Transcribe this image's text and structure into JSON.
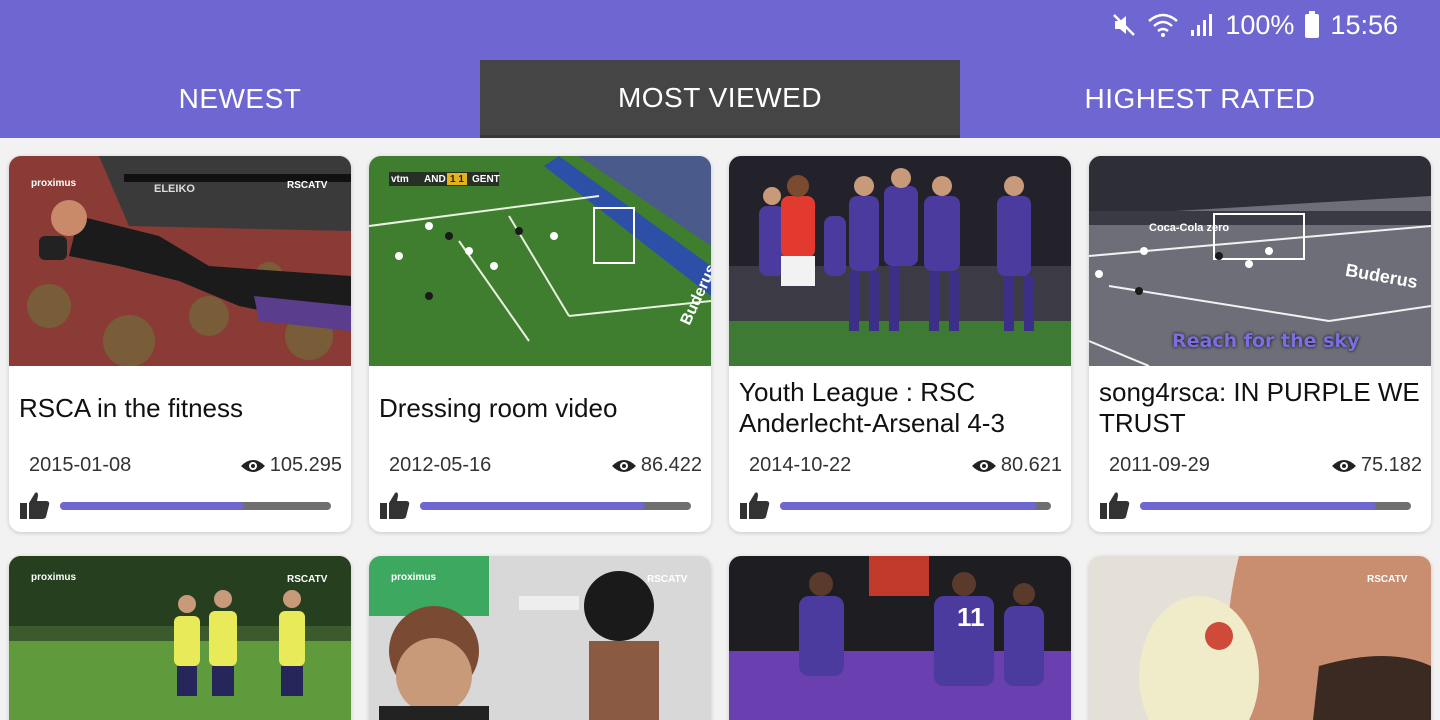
{
  "status": {
    "battery": "100%",
    "time": "15:56"
  },
  "tabs": [
    {
      "label": "NEWEST",
      "active": false
    },
    {
      "label": "MOST VIEWED",
      "active": true
    },
    {
      "label": "HIGHEST RATED",
      "active": false
    }
  ],
  "colors": {
    "accent": "#6f67d1",
    "active_tab": "#454545",
    "bar_track": "#6f6f6f"
  },
  "videos": [
    {
      "title": "RSCA in the fitness",
      "date": "2015-01-08",
      "views": "105.295",
      "rating": 0.68
    },
    {
      "title": "Dressing room video",
      "date": "2012-05-16",
      "views": "86.422",
      "rating": 0.83
    },
    {
      "title": "Youth League : RSC Anderlecht-Arsenal 4-3",
      "date": "2014-10-22",
      "views": "80.621",
      "rating": 0.95
    },
    {
      "title": "song4rsca: IN PURPLE WE TRUST",
      "date": "2011-09-29",
      "views": "75.182",
      "rating": 0.87
    }
  ],
  "thumb_overlays": {
    "proximus": "proximus",
    "rscatv": "RSCATV",
    "score_home": "AND",
    "score": "1 1",
    "score_away": "GENT",
    "vtm": "vtm",
    "buderus": "Buderus",
    "eleiko": "ELEIKO",
    "coca_cola": "Coca-Cola zero",
    "caption": "Reach for the sky",
    "shirt_number": "11"
  }
}
